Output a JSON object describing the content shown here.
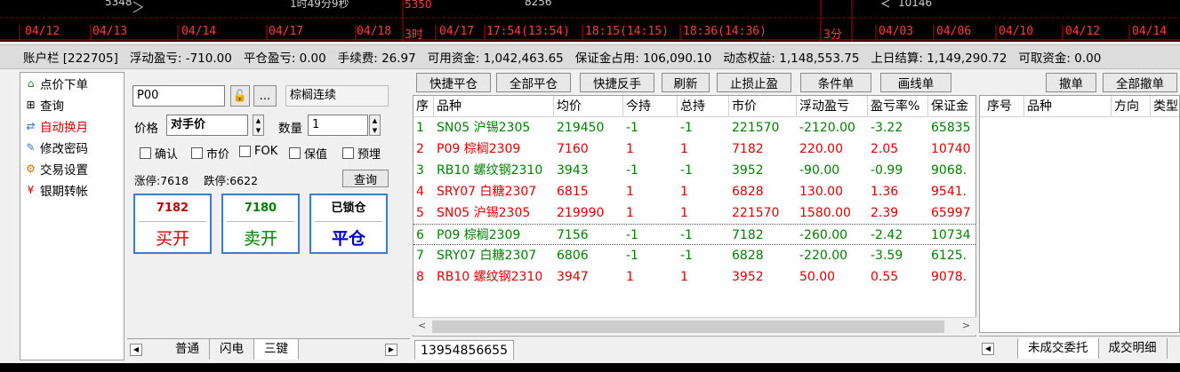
{
  "chart_strip": {
    "top_labels": [
      "5348",
      "1时49分9秒",
      "5350",
      "8256",
      "10146"
    ],
    "dates_left": [
      "04/12",
      "04/13",
      "04/14",
      "04/17",
      "04/18"
    ],
    "period_mid": "3时",
    "dates_mid": [
      "04/17",
      "17:54(13:54)",
      "18:15(14:15)",
      "18:36(14:36)"
    ],
    "period_right": "3分",
    "dates_right": [
      "04/03",
      "04/06",
      "04/10",
      "04/12",
      "04/14"
    ]
  },
  "account_bar": [
    "账户栏 [222705]",
    "浮动盈亏: -710.00",
    "平仓盈亏: 0.00",
    "手续费: 26.97",
    "可用资金: 1,042,463.65",
    "保证金占用: 106,090.10",
    "动态权益: 1,148,553.75",
    "上日结算: 1,149,290.72",
    "可取资金: 0.00"
  ],
  "nav": [
    {
      "label": "点价下单",
      "icon": "house-icon",
      "glyph": "⌂",
      "color": "#1a8a1a"
    },
    {
      "label": "查询",
      "icon": "plus-box-icon",
      "glyph": "⊞",
      "color": "#000"
    },
    {
      "label": "自动换月",
      "icon": "swap-icon",
      "glyph": "⇄",
      "color": "#3a6fd0"
    },
    {
      "label": "修改密码",
      "icon": "edit-icon",
      "glyph": "✎",
      "color": "#3a6fd0"
    },
    {
      "label": "交易设置",
      "icon": "gear-icon",
      "glyph": "⚙",
      "color": "#d07000"
    },
    {
      "label": "银期转帐",
      "icon": "yen-icon",
      "glyph": "¥",
      "color": "#c00000"
    }
  ],
  "order": {
    "symbol": "P00",
    "symbol_name": "棕榈连续",
    "more": "...",
    "price_label": "价格",
    "price_value": "对手价",
    "qty_label": "数量",
    "qty_value": "1",
    "checks": [
      "确认",
      "市价",
      "FOK",
      "保值",
      "预埋"
    ],
    "limit_up": "涨停:7618",
    "limit_down": "跌停:6622",
    "query_btn": "查询",
    "buy_price": "7182",
    "buy_label": "买开",
    "sell_price": "7180",
    "sell_label": "卖开",
    "close_top": "已锁仓",
    "close_label": "平仓",
    "tabs": [
      "普通",
      "闪电",
      "三键"
    ]
  },
  "toolbar": [
    "快捷平仓",
    "全部平仓",
    "快捷反手",
    "刷新",
    "止损止盈",
    "条件单",
    "画线单",
    "撤单",
    "全部撤单"
  ],
  "positions": {
    "headers": [
      "序",
      "品种",
      "均价",
      "今持",
      "总持",
      "市价",
      "浮动盈亏",
      "盈亏率%",
      "保证金"
    ],
    "rows": [
      {
        "cells": [
          "1",
          "SN05 沪锡2305",
          "219450",
          "-1",
          "-1",
          "221570",
          "-2120.00",
          "-3.22",
          "65835"
        ],
        "color": "green"
      },
      {
        "cells": [
          "2",
          "P09 棕榈2309",
          "7160",
          "1",
          "1",
          "7182",
          "220.00",
          "2.05",
          "10740"
        ],
        "color": "red"
      },
      {
        "cells": [
          "3",
          "RB10 螺纹钢2310",
          "3943",
          "-1",
          "-1",
          "3952",
          "-90.00",
          "-0.99",
          "9068."
        ],
        "color": "green"
      },
      {
        "cells": [
          "4",
          "SRY07 白糖2307",
          "6815",
          "1",
          "1",
          "6828",
          "130.00",
          "1.36",
          "9541."
        ],
        "color": "red"
      },
      {
        "cells": [
          "5",
          "SN05 沪锡2305",
          "219990",
          "1",
          "1",
          "221570",
          "1580.00",
          "2.39",
          "65997"
        ],
        "color": "red"
      },
      {
        "cells": [
          "6",
          "P09 棕榈2309",
          "7156",
          "-1",
          "-1",
          "7182",
          "-260.00",
          "-2.42",
          "10734"
        ],
        "color": "green"
      },
      {
        "cells": [
          "7",
          "SRY07 白糖2307",
          "6806",
          "-1",
          "-1",
          "6828",
          "-220.00",
          "-3.59",
          "6125."
        ],
        "color": "green"
      },
      {
        "cells": [
          "8",
          "RB10 螺纹钢2310",
          "3947",
          "1",
          "1",
          "3952",
          "50.00",
          "0.55",
          "9078."
        ],
        "color": "red"
      }
    ],
    "account_tab": "13954856655"
  },
  "orders": {
    "headers": [
      "序号",
      "品种",
      "方向",
      "类型"
    ],
    "tabs": [
      "未成交委托",
      "成交明细"
    ]
  }
}
